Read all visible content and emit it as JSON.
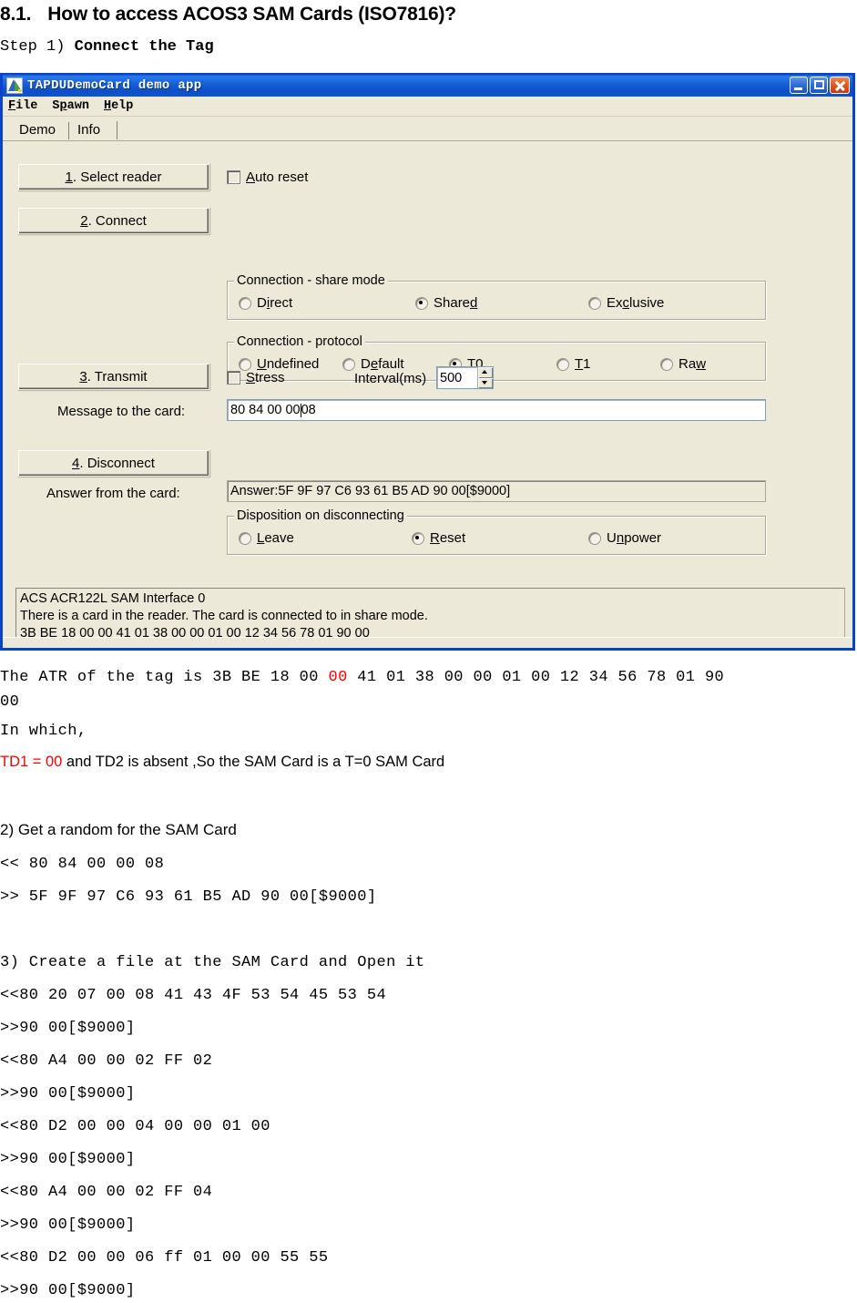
{
  "document": {
    "heading_number": "8.1.",
    "heading_text": "How to access ACOS3 SAM Cards (ISO7816)?",
    "step_prefix": "Step 1) ",
    "step_bold": "Connect the Tag",
    "atr_line_1_pre": "The ATR of the tag is 3B BE 18 00 ",
    "atr_line_1_red": "00",
    "atr_line_1_post": " 41 01 38 00 00 01 00 12 34 56 78 01 90",
    "atr_line_2": "00",
    "in_which": "In which,",
    "td1_red": "TD1 = 00",
    "td1_rest": " and TD2 is absent ,So the SAM Card is a T=0 SAM Card",
    "section2_title": "2) Get a random for the SAM Card",
    "section2_lines": [
      "<< 80 84 00 00 08",
      ">> 5F 9F 97 C6 93 61 B5 AD 90 00[$9000]"
    ],
    "section3_title": "3) Create a file at the SAM Card and Open it",
    "section3_lines": [
      "<<80 20 07 00 08 41 43 4F 53 54 45 53 54",
      ">>90 00[$9000]",
      "<<80 A4 00 00 02 FF 02",
      ">>90 00[$9000]",
      "<<80 D2 00 00 04 00 00 01 00",
      ">>90 00[$9000]",
      "<<80 A4 00 00 02 FF 04",
      ">>90 00[$9000]",
      "<<80 D2 00 00 06 ff 01 00 00 55 55",
      ">>90 00[$9000]"
    ]
  },
  "app": {
    "title": "TAPDUDemoCard demo app",
    "menu": [
      {
        "pre": "",
        "accel": "F",
        "post": "ile"
      },
      {
        "pre": "S",
        "accel": "p",
        "post": "awn"
      },
      {
        "pre": "",
        "accel": "H",
        "post": "elp"
      }
    ],
    "tabs": [
      {
        "label": "Demo",
        "active": true
      },
      {
        "label": "Info",
        "active": false
      }
    ],
    "window_buttons": {
      "minimize": "minimize-button",
      "maximize": "maximize-button",
      "close": "close-button"
    },
    "buttons": {
      "select_reader": {
        "accel": "1",
        "rest": ". Select reader"
      },
      "connect": {
        "accel": "2",
        "rest": ". Connect"
      },
      "transmit": {
        "accel": "3",
        "rest": ". Transmit"
      },
      "disconnect": {
        "accel": "4",
        "rest": ". Disconnect"
      }
    },
    "auto_reset": {
      "pre": "",
      "accel": "A",
      "post": "uto reset",
      "checked": false
    },
    "stress": {
      "pre": "",
      "accel": "S",
      "post": "tress",
      "checked": false
    },
    "share_mode": {
      "title": "Connection - share mode",
      "options": [
        {
          "pre": "D",
          "accel": "i",
          "post": "rect",
          "checked": false
        },
        {
          "pre": "Share",
          "accel": "d",
          "post": "",
          "checked": true
        },
        {
          "pre": "Ex",
          "accel": "c",
          "post": "lusive",
          "checked": false
        }
      ]
    },
    "protocol": {
      "title": "Connection - protocol",
      "options": [
        {
          "pre": "",
          "accel": "U",
          "post": "ndefined",
          "checked": false
        },
        {
          "pre": "D",
          "accel": "e",
          "post": "fault",
          "checked": false
        },
        {
          "pre": "T",
          "accel": "0",
          "post": "",
          "checked": true
        },
        {
          "pre": "",
          "accel": "T",
          "post": "1",
          "checked": false
        },
        {
          "pre": "Ra",
          "accel": "w",
          "post": "",
          "checked": false
        }
      ]
    },
    "disposition": {
      "title": "Disposition on disconnecting",
      "options": [
        {
          "pre": "",
          "accel": "L",
          "post": "eave",
          "checked": false
        },
        {
          "pre": "",
          "accel": "R",
          "post": "eset",
          "checked": true
        },
        {
          "pre": "U",
          "accel": "n",
          "post": "power",
          "checked": false
        }
      ]
    },
    "message_label": "Message to the card:",
    "message_value_before_caret": "80 84 00 00 ",
    "message_value_after_caret": "08",
    "answer_label": "Answer from the card:",
    "answer_value": "Answer:5F 9F 97 C6 93 61 B5 AD 90 00[$9000]",
    "interval_label": "Interval(ms)",
    "interval_value": "500",
    "log_lines": [
      "ACS ACR122L SAM Interface 0",
      "There is a card in the reader. The card is connected to in share mode.",
      "3B BE 18 00 00 41 01 38 00 00 01 00 12 34 56 78 01 90 00"
    ]
  },
  "colors": {
    "title_bar": "#0b43c8",
    "window_face": "#ece9d8",
    "accent_red": "#ff0000"
  }
}
